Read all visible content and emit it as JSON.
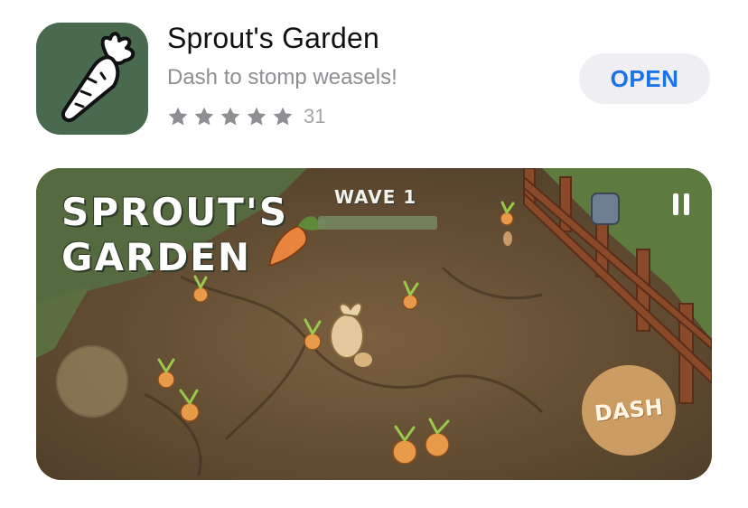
{
  "app": {
    "title": "Sprout's Garden",
    "subtitle": "Dash to stomp weasels!",
    "rating_stars": 5,
    "rating_count": "31",
    "open_label": "OPEN",
    "icon": "carrot-icon",
    "icon_bg": "#496a4f",
    "accent": "#1a73e8"
  },
  "screenshot": {
    "logo_line1": "SPROUT'S",
    "logo_line2": "GARDEN",
    "wave_label": "WAVE 1",
    "dash_label": "DASH",
    "pause_icon": "pause-icon"
  }
}
